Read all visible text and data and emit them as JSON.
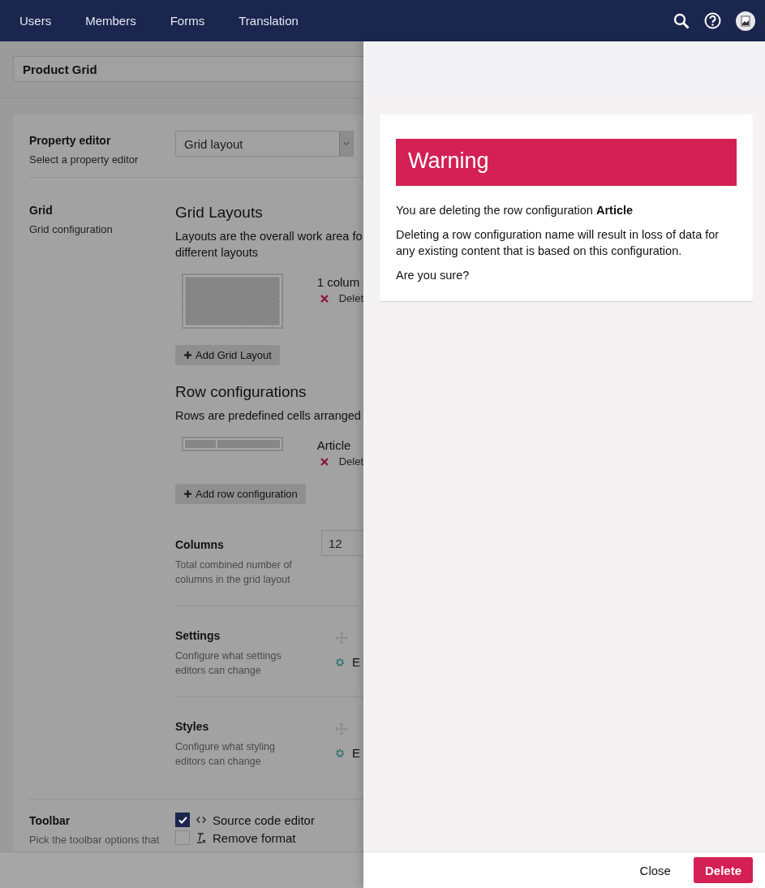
{
  "nav": {
    "items": [
      {
        "label": "Users"
      },
      {
        "label": "Members"
      },
      {
        "label": "Forms"
      },
      {
        "label": "Translation"
      }
    ]
  },
  "header": {
    "name": "Product Grid"
  },
  "property_editor": {
    "label": "Property editor",
    "description": "Select a property editor",
    "value": "Grid layout"
  },
  "grid": {
    "label": "Grid",
    "description": "Grid configuration",
    "layouts": {
      "title": "Grid Layouts",
      "description": [
        "Layouts are the overall work area fo",
        "different layouts"
      ],
      "items": [
        {
          "name": "1 colum",
          "delete": "Delet"
        }
      ],
      "add": "Add Grid Layout"
    },
    "rows": {
      "title": "Row configurations",
      "description": [
        "Rows are predefined cells arranged"
      ],
      "items": [
        {
          "name": "Article",
          "delete": "Delet"
        }
      ],
      "add": "Add row configuration"
    },
    "settings": [
      {
        "kind": "number",
        "label": "Columns",
        "description": "Total combined number of columns in the grid layout",
        "value": "12"
      },
      {
        "kind": "editors",
        "label": "Settings",
        "description": "Configure what settings editors can change",
        "edit": "E"
      },
      {
        "kind": "editors",
        "label": "Styles",
        "description": "Configure what styling editors can change",
        "edit": "E"
      }
    ]
  },
  "toolbar": {
    "label": "Toolbar",
    "description": "Pick the toolbar options that",
    "options": [
      {
        "label": "Source code editor",
        "checked": true,
        "kind": "code"
      },
      {
        "label": "Remove format",
        "checked": false,
        "kind": "format"
      }
    ]
  },
  "dialog": {
    "title": "Warning",
    "paragraphs": [
      "You are deleting the row configuration **Article**",
      "Deleting a row configuration name will result in loss of data for any existing content that is based on this configuration.",
      "Are you sure?"
    ],
    "buttons": [
      {
        "label": "Close",
        "kind": "link"
      },
      {
        "label": "Delete",
        "kind": "primary"
      }
    ]
  }
}
